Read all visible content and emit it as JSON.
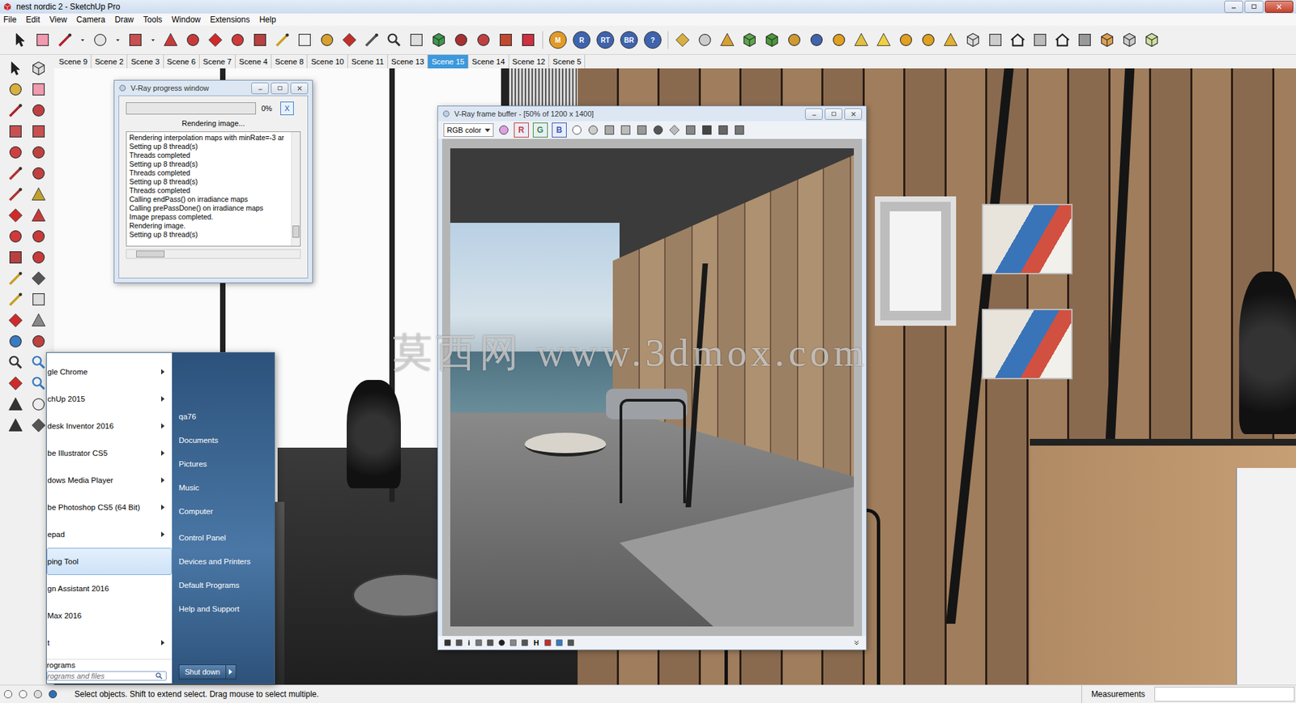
{
  "window": {
    "title": "nest nordic 2 - SketchUp Pro"
  },
  "menu": [
    "File",
    "Edit",
    "View",
    "Camera",
    "Draw",
    "Tools",
    "Window",
    "Extensions",
    "Help"
  ],
  "vray_toolbar": [
    {
      "label": "M",
      "color": "#e09a2a"
    },
    {
      "label": "R",
      "color": "#3f63ad"
    },
    {
      "label": "RT",
      "color": "#3f63ad"
    },
    {
      "label": "BR",
      "color": "#3f63ad"
    },
    {
      "label": "?",
      "color": "#3f63ad"
    }
  ],
  "scene_tabs": [
    {
      "label": "Scene 9",
      "selected": false
    },
    {
      "label": "Scene 2",
      "selected": false
    },
    {
      "label": "Scene 3",
      "selected": false
    },
    {
      "label": "Scene 6",
      "selected": false
    },
    {
      "label": "Scene 7",
      "selected": false
    },
    {
      "label": "Scene 4",
      "selected": false
    },
    {
      "label": "Scene 8",
      "selected": false
    },
    {
      "label": "Scene 10",
      "selected": false
    },
    {
      "label": "Scene 11",
      "selected": false
    },
    {
      "label": "Scene 13",
      "selected": false
    },
    {
      "label": "Scene 15",
      "selected": true
    },
    {
      "label": "Scene 14",
      "selected": false
    },
    {
      "label": "Scene 12",
      "selected": false
    },
    {
      "label": "Scene 5",
      "selected": false
    }
  ],
  "progress_window": {
    "title": "V-Ray progress window",
    "level": 0,
    "reading": "0%",
    "cancel": "X",
    "status": "Rendering image...",
    "log": [
      "Rendering interpolation maps with minRate=-3 ar",
      "Setting up 8 thread(s)",
      "Threads completed",
      "Setting up 8 thread(s)",
      "Threads completed",
      "Setting up 8 thread(s)",
      "Threads completed",
      "Calling endPass() on irradiance maps",
      "Calling prePassDone() on irradiance maps",
      "Image prepass completed.",
      "Rendering image.",
      "Setting up 8 thread(s)"
    ]
  },
  "frame_buffer": {
    "title": "V-Ray frame buffer - [50% of 1200 x 1400]",
    "channel_select": "RGB color",
    "channels": [
      {
        "label": "R",
        "selected": true,
        "color": "#c83a3a"
      },
      {
        "label": "G",
        "selected": true,
        "color": "#3a8a3a"
      },
      {
        "label": "B",
        "selected": true,
        "color": "#3a55b8"
      }
    ],
    "bottom_glyphs": [
      "i",
      "H"
    ]
  },
  "watermark": "莫西网 www.3dmox.com",
  "start_menu": {
    "programs": [
      {
        "label": "gle Chrome",
        "submenu": true,
        "selected": false
      },
      {
        "label": "chUp 2015",
        "submenu": true,
        "selected": false
      },
      {
        "label": "desk Inventor 2016",
        "submenu": true,
        "selected": false
      },
      {
        "label": "be Illustrator CS5",
        "submenu": true,
        "selected": false
      },
      {
        "label": "dows Media Player",
        "submenu": true,
        "selected": false
      },
      {
        "label": "be Photoshop CS5 (64 Bit)",
        "submenu": true,
        "selected": false
      },
      {
        "label": "epad",
        "submenu": true,
        "selected": false
      },
      {
        "label": "ping Tool",
        "submenu": false,
        "selected": true
      },
      {
        "label": "gn Assistant 2016",
        "submenu": false,
        "selected": false
      },
      {
        "label": "Max 2016",
        "submenu": false,
        "selected": false
      },
      {
        "label": "t",
        "submenu": true,
        "selected": false
      }
    ],
    "all_programs": "rograms",
    "search_placeholder": "rograms and files",
    "places": [
      "qa76",
      "Documents",
      "Pictures",
      "Music",
      "Computer",
      "Control Panel",
      "Devices and Printers",
      "Default Programs",
      "Help and Support"
    ],
    "shutdown": "Shut down"
  },
  "status_bar": {
    "hint": "Select objects. Shift to extend select. Drag mouse to select multiple.",
    "measurements_label": "Measurements"
  }
}
